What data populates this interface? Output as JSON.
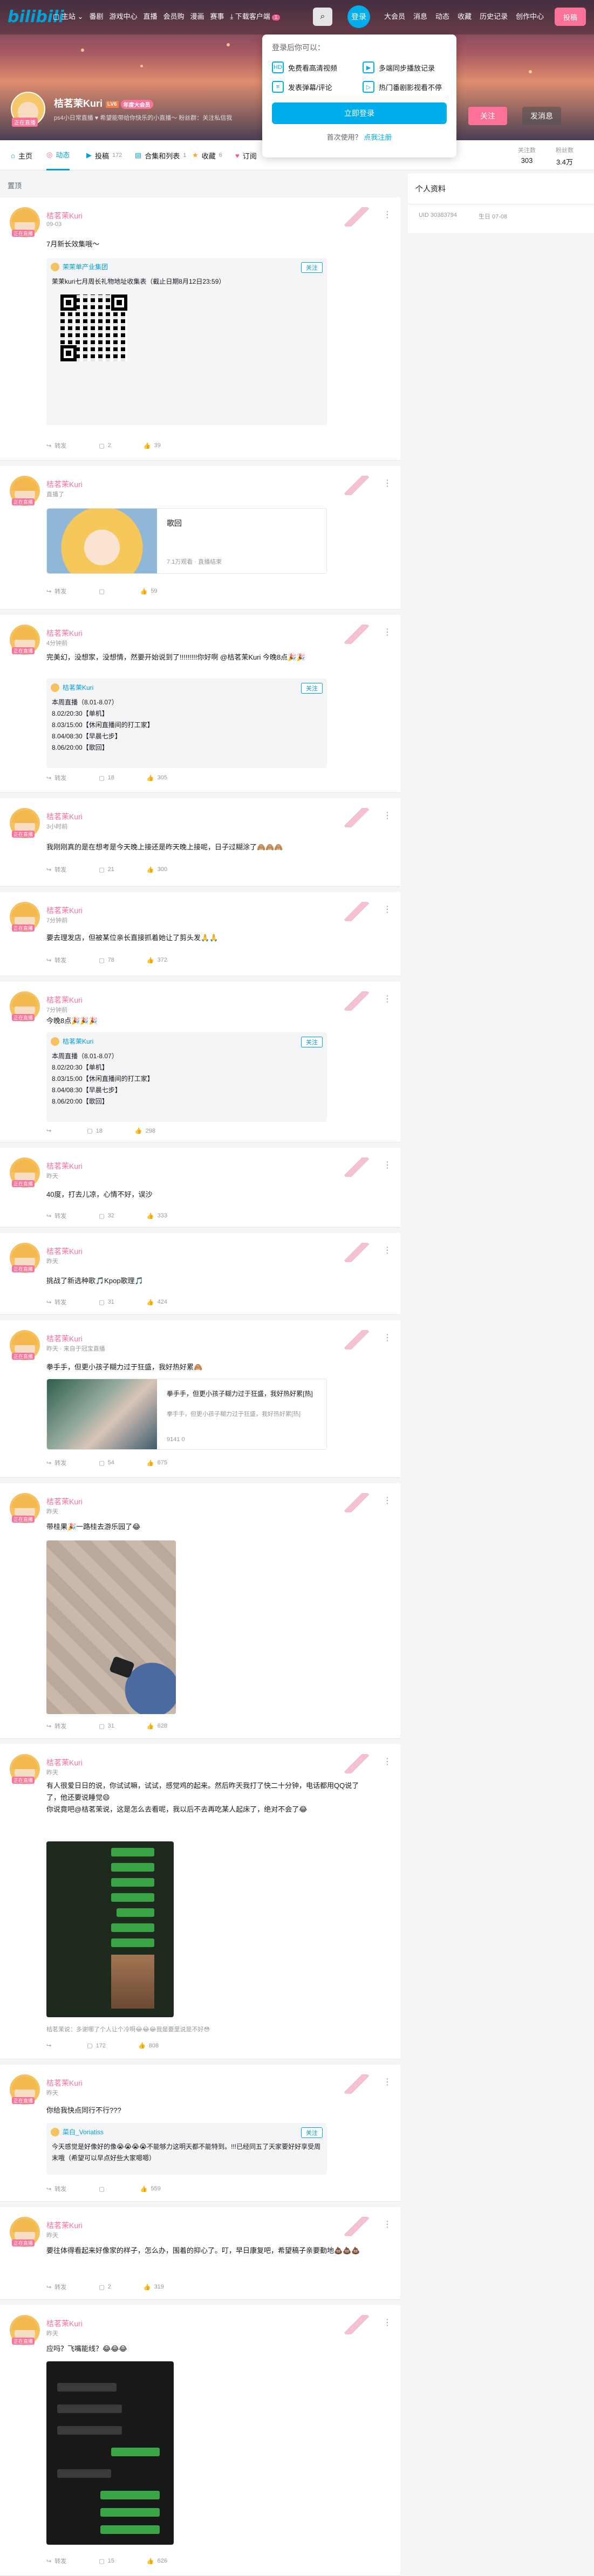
{
  "header": {
    "logo": "bilibili",
    "nav": [
      {
        "label": "主站",
        "icon": "tv-icon"
      },
      {
        "label": "番剧"
      },
      {
        "label": "游戏中心"
      },
      {
        "label": "直播"
      },
      {
        "label": "会员购"
      },
      {
        "label": "漫画"
      },
      {
        "label": "赛事"
      },
      {
        "label": "下载客户端",
        "icon": "download-icon",
        "badge": "1"
      }
    ],
    "login_label": "登录",
    "right_nav": [
      "大会员",
      "消息",
      "动态",
      "收藏",
      "历史记录",
      "创作中心"
    ],
    "upload_label": "投稿"
  },
  "login_popup": {
    "title": "登录后你可以：",
    "perks": [
      "免费看高清视频",
      "多端同步播放记录",
      "发表弹幕/评论",
      "热门番剧影视看不停"
    ],
    "button": "立即登录",
    "register_prefix": "首次使用？",
    "register_link": "点我注册"
  },
  "profile": {
    "name": "桔茗茉Kuri",
    "level": "LV6",
    "vip": "年度大会员",
    "sign": "ps4小日常直播 ♥ 希望能带给你快乐的小直播～ 粉丝群：关注私信我",
    "avatar_caption": "正在直播",
    "follow_label": "关注",
    "message_label": "发消息"
  },
  "tabs": [
    {
      "label": "主页",
      "icon": "home-icon",
      "count": ""
    },
    {
      "label": "动态",
      "icon": "dynamic-icon",
      "count": ""
    },
    {
      "label": "投稿",
      "icon": "video-icon",
      "count": "172"
    },
    {
      "label": "合集和列表",
      "icon": "collection-icon",
      "count": "1"
    },
    {
      "label": "收藏",
      "icon": "star-icon",
      "count": "6"
    },
    {
      "label": "订阅",
      "icon": "subscribe-icon",
      "count": ""
    }
  ],
  "stats": [
    {
      "label": "关注数",
      "value": "303"
    },
    {
      "label": "粉丝数",
      "value": "3.4万"
    }
  ],
  "section_title": "置顶",
  "sidebar": {
    "title": "个人资料",
    "uid_label": "UID",
    "uid": "30383794",
    "birthday_label": "生日",
    "birthday": "07-08"
  },
  "posts": [
    {
      "name": "桔茗茉Kuri",
      "time": "09-03",
      "text": "7月新长效集哦～",
      "forward": {
        "author": "茉茉单产业集团",
        "button": "",
        "text": "茉茉kuri七月周长礼物地址收集表（截止日期8月12日23:59）"
      },
      "footer": {
        "share": "转发",
        "comment": "2",
        "like": "39"
      }
    },
    {
      "name": "桔茗茉Kuri",
      "time": "直播了",
      "text": "",
      "link": {
        "title": "歌回",
        "sub": "7.1万观看 · 直播结束"
      },
      "footer": {
        "share": "转发",
        "comment": "",
        "like": "59"
      }
    },
    {
      "name": "桔茗茉Kuri",
      "time": "4分钟前",
      "text": "完美幻，没想家，没想情，然要开始说到了!!!!!!!!!你好啊 @桔茗茉Kuri 今晚8点🎉🎉",
      "forward": {
        "author": "桔茗茉Kuri",
        "button": "关注",
        "text": "本周直播（8.01-8.07）\n8.02/20:30【单机】\n8.03/15:00【休闲直播间的打工家】\n8.04/08:30【早晨七步】\n8.06/20:00【歌回】"
      },
      "footer": {
        "share": "转发",
        "comment": "18",
        "like": "305"
      }
    },
    {
      "name": "桔茗茉Kuri",
      "time": "3小时前",
      "text": "我刚刚真的是在想考是今天晚上接还是昨天晚上接呢，日子过糊涂了🙈🙈🙈",
      "footer": {
        "share": "转发",
        "comment": "21",
        "like": "300"
      }
    },
    {
      "name": "桔茗茉Kuri",
      "time": "7分钟前",
      "text": "要去理发店，但被某位亲长直接抓着她让了剪头发🙏🙏",
      "footer": {
        "share": "转发",
        "comment": "78",
        "like": "372"
      }
    },
    {
      "name": "桔茗茉Kuri",
      "time": "7分钟前",
      "text": "今晚8点🎉🎉🎉",
      "forward": {
        "author": "桔茗茉Kuri",
        "button": "关注",
        "text": "本周直播（8.01-8.07）\n8.02/20:30【单机】\n8.03/15:00【休闲直播间的打工家】\n8.04/08:30【早晨七步】\n8.06/20:00【歌回】"
      },
      "footer": {
        "share": "",
        "comment": "18",
        "like": "298"
      }
    },
    {
      "name": "桔茗茉Kuri",
      "time": "昨天",
      "text": "40度，打去儿凉，心情不好，误沙",
      "footer": {
        "share": "转发",
        "comment": "32",
        "like": "333"
      }
    },
    {
      "name": "桔茗茉Kuri",
      "time": "昨天",
      "text": "挑战了新选种歌🎵Kpop歌理🎵",
      "footer": {
        "share": "转发",
        "comment": "31",
        "like": "424"
      }
    },
    {
      "name": "桔茗茉Kuri",
      "time": "昨天 · 来自于冠宝直播",
      "text": "拳手手，但更小孩子糊力过于狂盛，我好热好累🙈",
      "link": {
        "title": "拳手手，但更小孩子糊力过于狂盛，我好热好累[热]",
        "sub": "拳手手，但更小孩子糊力过于狂盛，我好热好累[热]"
      },
      "link_stats": "9141    0",
      "footer": {
        "share": "转发",
        "comment": "54",
        "like": "675"
      }
    },
    {
      "name": "桔茗茉Kuri",
      "time": "昨天",
      "text": "带桂果🎉一路桂去游乐园了😂",
      "footer": {
        "share": "转发",
        "comment": "31",
        "like": "628"
      }
    },
    {
      "name": "桔茗茉Kuri",
      "time": "昨天",
      "text": "有人很爱日日的说，你试试嘛，试试，感觉鸡的起来。然后昨天我打了快二十分钟，电话都用QQ说了了，他还要说睡觉😄\n你说竟吧@桔茗茉说，这是怎么去看呢，我以后不去再吃某人起床了，绝对不会了😂",
      "comment_note": "桔茗茉说：多谢哪了个人让个冷啊😂😂😂我是要里说是不好😳",
      "footer": {
        "share": "",
        "comment": "172",
        "like": "808"
      }
    },
    {
      "name": "桔茗茉Kuri",
      "time": "昨天",
      "text": "你给我快点同行不行???",
      "forward": {
        "author": "菜白_Voriatiss",
        "button": "关注",
        "text": "今天感觉是好像好的像😭😭😭😭不能够力这明天都不能特到。!!!已经同五了天家要好好享受周末哦（希望可以早点好些大家嗯嗯）"
      },
      "footer": {
        "share": "转发",
        "comment": "",
        "like": "559"
      }
    },
    {
      "name": "桔茗茉Kuri",
      "time": "昨天",
      "text": "要往体得看起来好像家的样子，怎么办，围着的抑心了。叮，早日康复吧，希望稿子亲要勤地💩💩💩",
      "footer": {
        "share": "转发",
        "comment": "2",
        "like": "319"
      }
    },
    {
      "name": "桔茗茉Kuri",
      "time": "昨天",
      "text": "应吗？飞嘴能线？😂😂😂",
      "footer": {
        "share": "转发",
        "comment": "15",
        "like": "626"
      }
    }
  ]
}
